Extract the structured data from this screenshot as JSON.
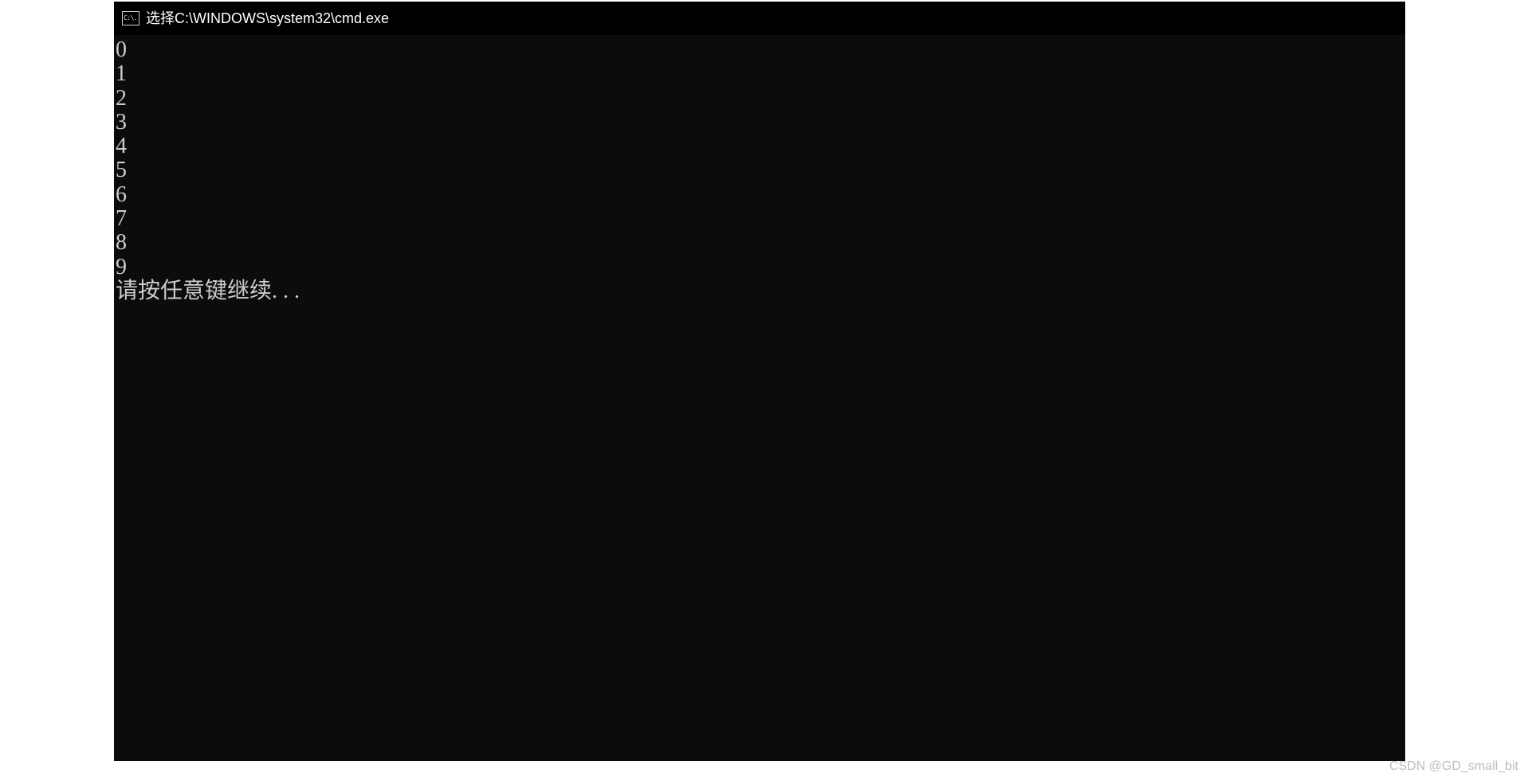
{
  "window": {
    "title": "选择C:\\WINDOWS\\system32\\cmd.exe",
    "icon": {
      "name": "cmd-icon",
      "glyph": "C:\\."
    }
  },
  "console": {
    "lines": [
      "0",
      "1",
      "2",
      "3",
      "4",
      "5",
      "6",
      "7",
      "8",
      "9",
      "请按任意键继续. . ."
    ]
  },
  "watermark": "CSDN @GD_small_bit",
  "colors": {
    "console_background": "#0c0c0c",
    "titlebar_background": "#000000",
    "console_text": "#cccccc",
    "title_text": "#ffffff"
  }
}
